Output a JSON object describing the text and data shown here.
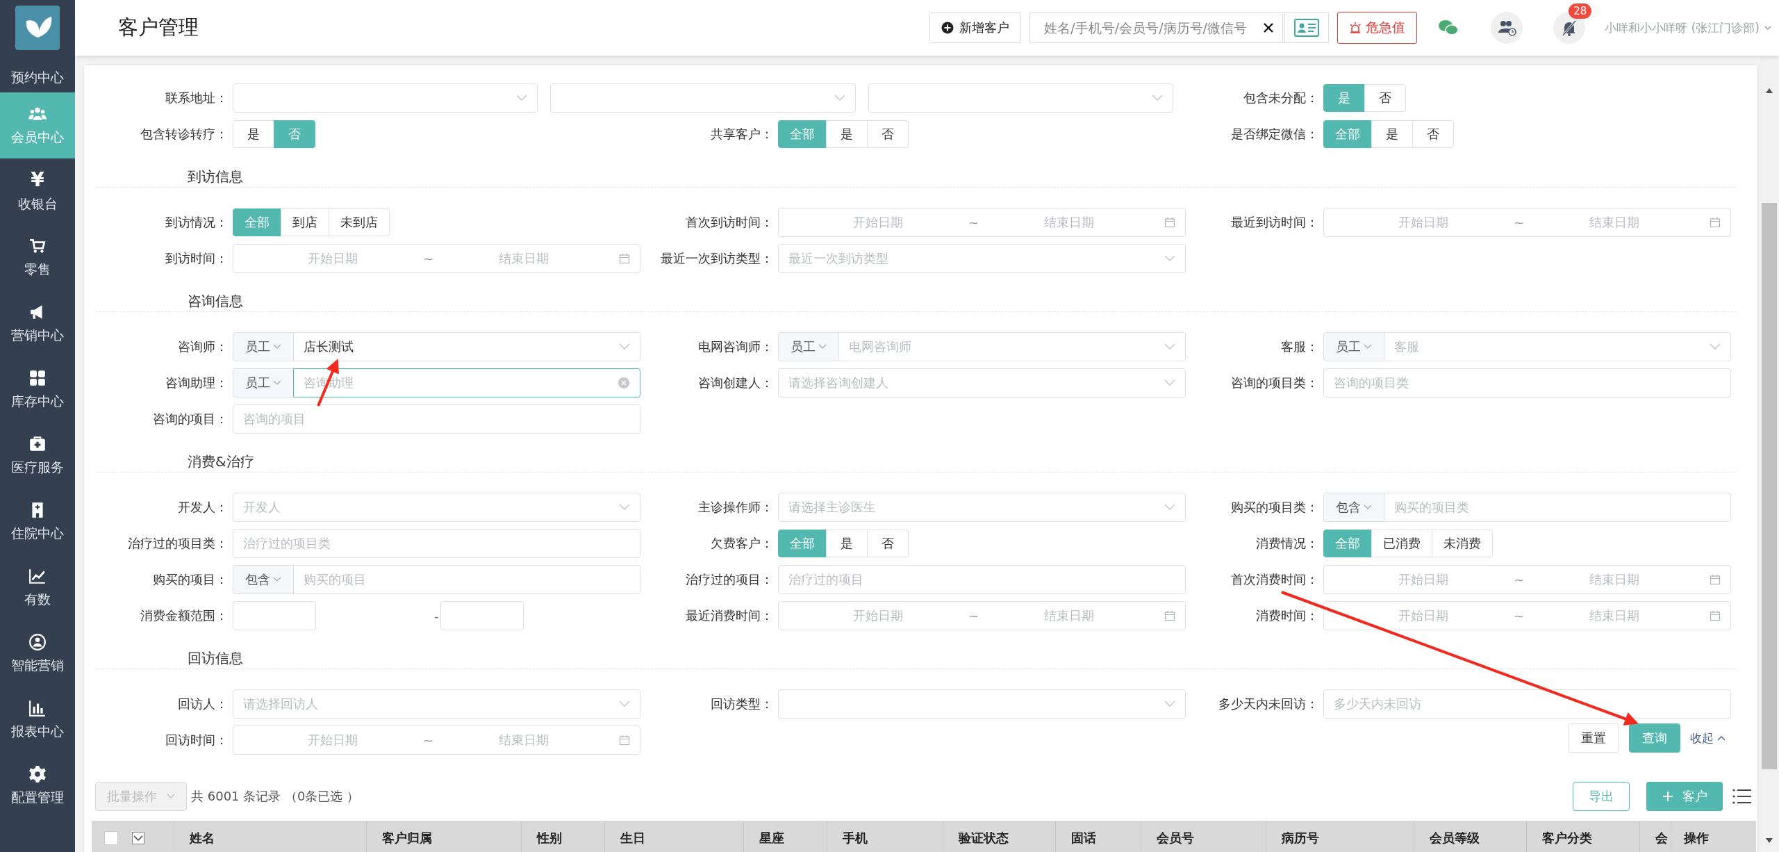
{
  "sidebar": {
    "items": [
      {
        "label": "预约中心",
        "selected": false
      },
      {
        "label": "会员中心",
        "selected": true
      },
      {
        "label": "收银台",
        "selected": false,
        "icon_char": "¥"
      },
      {
        "label": "零售",
        "selected": false
      },
      {
        "label": "营销中心",
        "selected": false
      },
      {
        "label": "库存中心",
        "selected": false
      },
      {
        "label": "医疗服务",
        "selected": false
      },
      {
        "label": "住院中心",
        "selected": false
      },
      {
        "label": "有数",
        "selected": false
      },
      {
        "label": "智能营销",
        "selected": false
      },
      {
        "label": "报表中心",
        "selected": false
      },
      {
        "label": "配置管理",
        "selected": false
      }
    ]
  },
  "header": {
    "title": "客户管理",
    "new_button": "新增客户",
    "search": {
      "placeholder": "姓名/手机号/会员号/病历号/微信号"
    },
    "alert_button": "危急值",
    "notification_badge": "28",
    "user": "小咩和小小咩呀 (张江门诊部)"
  },
  "form": {
    "blocks": [
      {
        "kind": "row",
        "items": [
          {
            "kind": "address",
            "label": "联系地址："
          },
          {
            "kind": "segmented",
            "label": "包含未分配：",
            "options": [
              {
                "label": "是",
                "selected": true
              },
              {
                "label": "否",
                "selected": false
              }
            ]
          }
        ]
      },
      {
        "kind": "row",
        "items": [
          {
            "kind": "segmented",
            "label": "包含转诊转疗：",
            "options": [
              {
                "label": "是",
                "selected": false
              },
              {
                "label": "否",
                "selected": true
              }
            ]
          },
          {
            "kind": "segmented",
            "label": "共享客户：",
            "options": [
              {
                "label": "全部",
                "selected": true
              },
              {
                "label": "是",
                "selected": false
              },
              {
                "label": "否",
                "selected": false
              }
            ]
          },
          {
            "kind": "segmented",
            "label": "是否绑定微信：",
            "options": [
              {
                "label": "全部",
                "selected": true
              },
              {
                "label": "是",
                "selected": false
              },
              {
                "label": "否",
                "selected": false
              }
            ]
          }
        ]
      },
      {
        "kind": "section",
        "title": "到访信息"
      },
      {
        "kind": "row",
        "items": [
          {
            "kind": "segmented",
            "label": "到访情况：",
            "options": [
              {
                "label": "全部",
                "selected": true
              },
              {
                "label": "到店",
                "selected": false
              },
              {
                "label": "未到店",
                "selected": false
              }
            ]
          },
          {
            "kind": "date_range",
            "label": "首次到访时间：",
            "start_placeholder": "开始日期",
            "separator": "~",
            "end_placeholder": "结束日期"
          },
          {
            "kind": "date_range",
            "label": "最近到访时间：",
            "start_placeholder": "开始日期",
            "separator": "~",
            "end_placeholder": "结束日期"
          }
        ]
      },
      {
        "kind": "row",
        "items": [
          {
            "kind": "date_range",
            "label": "到访时间：",
            "start_placeholder": "开始日期",
            "separator": "~",
            "end_placeholder": "结束日期"
          },
          {
            "kind": "select",
            "label": "最近一次到访类型：",
            "placeholder": "最近一次到访类型"
          }
        ]
      },
      {
        "kind": "section",
        "title": "咨询信息"
      },
      {
        "kind": "row",
        "items": [
          {
            "kind": "prefix_select",
            "label": "咨询师：",
            "prefix": "员工",
            "value": "店长测试",
            "focused": false
          },
          {
            "kind": "prefix_select",
            "label": "电网咨询师：",
            "prefix": "员工",
            "placeholder": "电网咨询师",
            "focused": false
          },
          {
            "kind": "prefix_select",
            "label": "客服：",
            "prefix": "员工",
            "placeholder": "客服",
            "focused": false
          }
        ]
      },
      {
        "kind": "row",
        "items": [
          {
            "kind": "prefix_select",
            "label": "咨询助理：",
            "prefix": "员工",
            "placeholder": "咨询助理",
            "focused": true
          },
          {
            "kind": "select",
            "label": "咨询创建人：",
            "placeholder": "请选择咨询创建人"
          },
          {
            "kind": "input",
            "label": "咨询的项目类：",
            "placeholder": "咨询的项目类"
          }
        ]
      },
      {
        "kind": "row",
        "items": [
          {
            "kind": "input",
            "label": "咨询的项目：",
            "placeholder": "咨询的项目"
          }
        ]
      },
      {
        "kind": "section",
        "title": "消费&治疗"
      },
      {
        "kind": "row",
        "items": [
          {
            "kind": "select",
            "label": "开发人：",
            "placeholder": "开发人"
          },
          {
            "kind": "select",
            "label": "主诊操作师：",
            "placeholder": "请选择主诊医生"
          },
          {
            "kind": "prefix_input",
            "label": "购买的项目类：",
            "prefix": "包含",
            "placeholder": "购买的项目类"
          }
        ]
      },
      {
        "kind": "row",
        "items": [
          {
            "kind": "input",
            "label": "治疗过的项目类：",
            "placeholder": "治疗过的项目类"
          },
          {
            "kind": "segmented",
            "label": "欠费客户：",
            "options": [
              {
                "label": "全部",
                "selected": true
              },
              {
                "label": "是",
                "selected": false
              },
              {
                "label": "否",
                "selected": false
              }
            ]
          },
          {
            "kind": "segmented",
            "label": "消费情况：",
            "options": [
              {
                "label": "全部",
                "selected": true
              },
              {
                "label": "已消费",
                "selected": false
              },
              {
                "label": "未消费",
                "selected": false
              }
            ]
          }
        ]
      },
      {
        "kind": "row",
        "items": [
          {
            "kind": "prefix_input",
            "label": "购买的项目：",
            "prefix": "包含",
            "placeholder": "购买的项目"
          },
          {
            "kind": "input",
            "label": "治疗过的项目：",
            "placeholder": "治疗过的项目"
          },
          {
            "kind": "date_range",
            "label": "首次消费时间：",
            "start_placeholder": "开始日期",
            "separator": "~",
            "end_placeholder": "结束日期"
          }
        ]
      },
      {
        "kind": "row",
        "items": [
          {
            "kind": "number_range",
            "label": "消费金额范围：",
            "separator": "-"
          },
          {
            "kind": "date_range",
            "label": "最近消费时间：",
            "start_placeholder": "开始日期",
            "separator": "~",
            "end_placeholder": "结束日期"
          },
          {
            "kind": "date_range",
            "label": "消费时间：",
            "start_placeholder": "开始日期",
            "separator": "~",
            "end_placeholder": "结束日期"
          }
        ]
      },
      {
        "kind": "section",
        "title": "回访信息"
      },
      {
        "kind": "row",
        "items": [
          {
            "kind": "select",
            "label": "回访人：",
            "placeholder": "请选择回访人"
          },
          {
            "kind": "select",
            "label": "回访类型："
          },
          {
            "kind": "input",
            "label": "多少天内未回访：",
            "placeholder": "多少天内未回访"
          }
        ]
      },
      {
        "kind": "row",
        "items": [
          {
            "kind": "date_range",
            "label": "回访时间：",
            "start_placeholder": "开始日期",
            "separator": "~",
            "end_placeholder": "结束日期"
          },
          {
            "kind": "actions",
            "buttons": [
              {
                "label": "重置",
                "kind": "default"
              },
              {
                "label": "查询",
                "kind": "primary"
              }
            ],
            "collapse_link": "收起"
          }
        ]
      }
    ]
  },
  "toolbar": {
    "batch_button": "批量操作",
    "batch_disabled": true,
    "summary": "共 6001 条记录 （0条已选 ）",
    "export_button": "导出",
    "add_button": "客户"
  },
  "table": {
    "select_all_checked": false,
    "columns": [
      "姓名",
      "客户归属",
      "性别",
      "生日",
      "星座",
      "手机",
      "验证状态",
      "固话",
      "会员号",
      "病历号",
      "会员等级",
      "客户分类",
      "会"
    ],
    "fixed_column": "操作"
  }
}
